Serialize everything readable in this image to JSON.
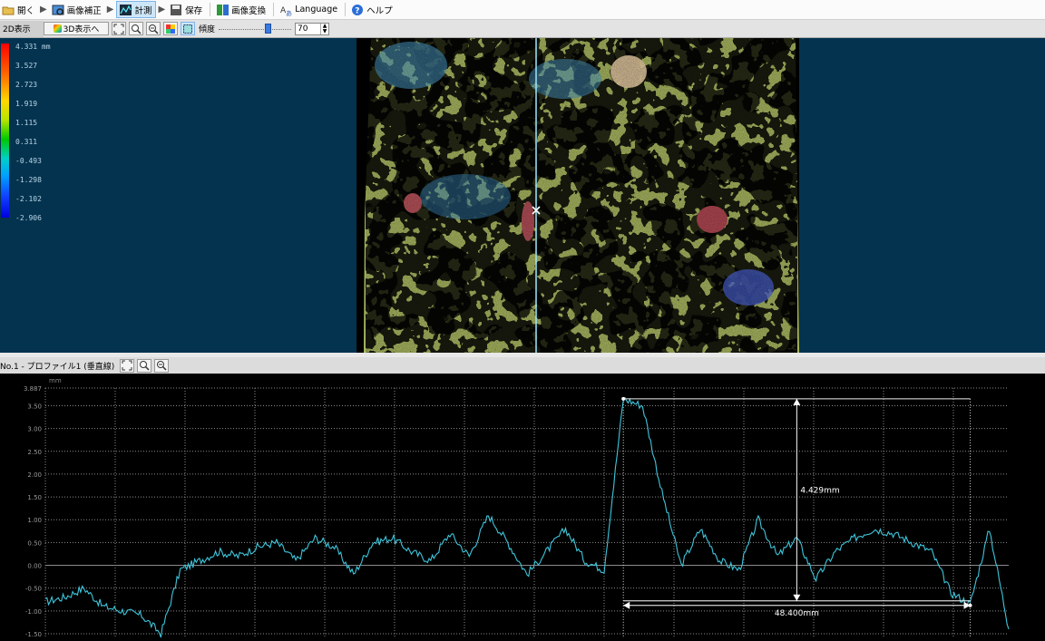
{
  "toolbar": {
    "items": [
      {
        "label": "開く",
        "icon": "folder-open-icon"
      },
      {
        "label": "画像補正",
        "icon": "image-correct-icon"
      },
      {
        "label": "計測",
        "icon": "measure-icon",
        "active": true
      },
      {
        "label": "保存",
        "icon": "save-icon"
      },
      {
        "label": "画像変換",
        "icon": "image-convert-icon"
      },
      {
        "label": "Language",
        "icon": "language-icon"
      },
      {
        "label": "ヘルプ",
        "icon": "help-icon"
      }
    ]
  },
  "view_toolbar": {
    "tab_2d": "2D表示",
    "to_3d": "3D表示へ",
    "gain_label": "傾度",
    "gain_value": "70",
    "slider_level": 0.7
  },
  "colorbar": {
    "labels": [
      "4.331 mm",
      "3.527",
      "2.723",
      "1.919",
      "1.115",
      "0.311",
      "-0.493",
      "-1.298",
      "-2.102",
      "-2.906"
    ]
  },
  "profile": {
    "title": "No.1 - プロファイル1 (垂直線)",
    "unit": "mm",
    "y_ticks": [
      "3.887",
      "3.50",
      "3.00",
      "2.50",
      "2.00",
      "1.50",
      "1.00",
      "0.50",
      "0.00",
      "-0.50",
      "-1.00",
      "-1.50"
    ],
    "height_label": "4.429mm",
    "width_label": "48.400mm"
  },
  "colors": {
    "background_view": "#04334f",
    "profile_line": "#3ec6dc",
    "grid": "#8a8a8a"
  },
  "chart_data": {
    "type": "line",
    "title": "No.1 - プロファイル1 (垂直線)",
    "ylabel": "mm",
    "ylim": [
      -1.6,
      3.887
    ],
    "series": [
      {
        "name": "プロファイル1",
        "x": [
          0,
          2,
          4,
          6,
          8,
          10,
          12,
          14,
          16,
          18,
          20,
          22,
          24,
          26,
          28,
          30,
          32,
          34,
          36,
          38,
          40,
          42,
          44,
          46,
          48,
          50,
          52,
          54,
          56,
          58,
          60,
          62,
          64,
          66,
          68,
          70,
          72,
          74,
          76,
          78,
          80,
          82,
          84,
          86,
          88,
          90,
          92,
          94,
          96,
          98,
          100
        ],
        "values": [
          -0.8,
          -0.7,
          -0.5,
          -0.9,
          -1.0,
          -1.1,
          -1.5,
          -0.1,
          0.1,
          0.3,
          0.2,
          0.4,
          0.5,
          0.1,
          0.6,
          0.4,
          -0.2,
          0.5,
          0.6,
          0.3,
          0.1,
          0.7,
          0.2,
          1.1,
          0.5,
          -0.2,
          0.3,
          0.8,
          0.1,
          -0.1,
          3.65,
          3.5,
          1.6,
          0.0,
          0.8,
          0.1,
          -0.1,
          1.0,
          0.2,
          0.6,
          -0.3,
          0.3,
          0.6,
          0.8,
          0.7,
          0.5,
          0.3,
          -0.6,
          -0.85,
          0.8,
          -1.4
        ]
      }
    ],
    "annotations": [
      "4.429mm",
      "48.400mm"
    ]
  }
}
